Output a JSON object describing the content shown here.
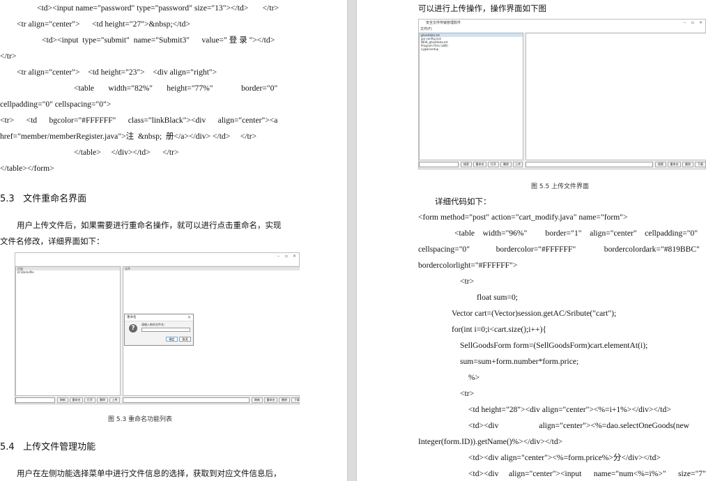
{
  "left_page": {
    "code_lines": [
      "<td><input name=\"password\" type=\"password\" size=\"13\"></td>       </tr>",
      "<tr align=\"center\">      <td height=\"27\">&nbsp;</td>",
      "<td><input  type=\"submit\"  name=\"Submit3\"      value=\" 登 录 \"></td>",
      "</tr>",
      "<tr align=\"center\">    <td height=\"23\">    <div align=\"right\">",
      "<table       width=\"82%\"       height=\"77%\"              border=\"0\"",
      "cellpadding=\"0\" cellspacing=\"0\">",
      "<tr>      <td      bgcolor=\"#FFFFFF\"      class=\"linkBlack\"><div      align=\"center\"><a",
      "href=\"member/memberRegister.java\">注  &nbsp;  册</a></div> </td>     </tr>",
      "</table>     </div></td>      </tr>",
      "</table></form>"
    ],
    "section_53": {
      "number": "5.3",
      "title": "文件重命名界面"
    },
    "para_53": [
      "用户上传文件后，如果需要进行重命名操作，就可以进行点击重命名，实现",
      "文件名修改，详细界面如下："
    ],
    "fig53": {
      "left_header": "目录",
      "left_items": [
        "D:\\Demofile"
      ],
      "right_header": "文件",
      "dialog_title": "重命名",
      "dialog_prompt": "请输入新的文件名：",
      "dialog_ok": "确定",
      "dialog_cancel": "取消",
      "q_icon": "?",
      "left_buttons": [
        "刷新",
        "重命名",
        "打开",
        "删除",
        "上传"
      ],
      "right_buttons": [
        "刷新",
        "重命名",
        "删除",
        "下载"
      ]
    },
    "caption_53": "图 5.3 重命名功能列表",
    "section_54": {
      "number": "5.4",
      "title": "上传文件管理功能"
    },
    "para_54": "用户在左侧功能选择菜单中进行文件信息的选择，获取到对应文件信息后，"
  },
  "right_page": {
    "intro": "可以进行上传操作，操作界面如下图",
    "fig55": {
      "title": "安全文件传输管理软件",
      "menu": "文件(F)",
      "left_items": [
        "ghostdata.txt",
        "jpo-config.json",
        "NEW_ghostdata.txt",
        "Program Files (x86)",
        "cygwinsetup"
      ],
      "left_buttons": [
        "搜索",
        "重命名",
        "打开",
        "删除",
        "上传"
      ],
      "right_buttons": [
        "搜索",
        "重命名",
        "删除",
        "下载"
      ]
    },
    "caption_55": "图 5.5 上传文件界面",
    "detail": "详细代码如下：",
    "code_lines": [
      "<form method=\"post\" action=\"cart_modify.java\" name=\"form\">",
      "<table    width=\"96%\"         border=\"1\"    align=\"center\"    cellpadding=\"0\"",
      "cellspacing=\"0\"             bordercolor=\"#FFFFFF\"              bordercolordark=\"#819BBC\"",
      "bordercolorlight=\"#FFFFFF\">",
      "<tr>",
      "float sum=0;",
      "Vector cart=(Vector)session.getAC/Sribute(\"cart\");",
      "for(int i=0;i<cart.size();i++){",
      "SellGoodsForm form=(SellGoodsForm)cart.elementAt(i);",
      "sum=sum+form.number*form.price;",
      "%>",
      "<tr>",
      "<td height=\"28\"><div align=\"center\"><%=i+1%></div></td>",
      "<td><div                    align=\"center\"><%=dao.selectOneGoods(new",
      "Integer(form.ID)).getName()%></div></td>",
      "<td><div align=\"center\"><%=form.price%>分</div></td>",
      "<td><div     align=\"center\"><input      name=\"num<%=i%>\"      size=\"7\""
    ]
  },
  "colors": {
    "squiggle": "#e05050",
    "divider": "#dcdcdc"
  }
}
